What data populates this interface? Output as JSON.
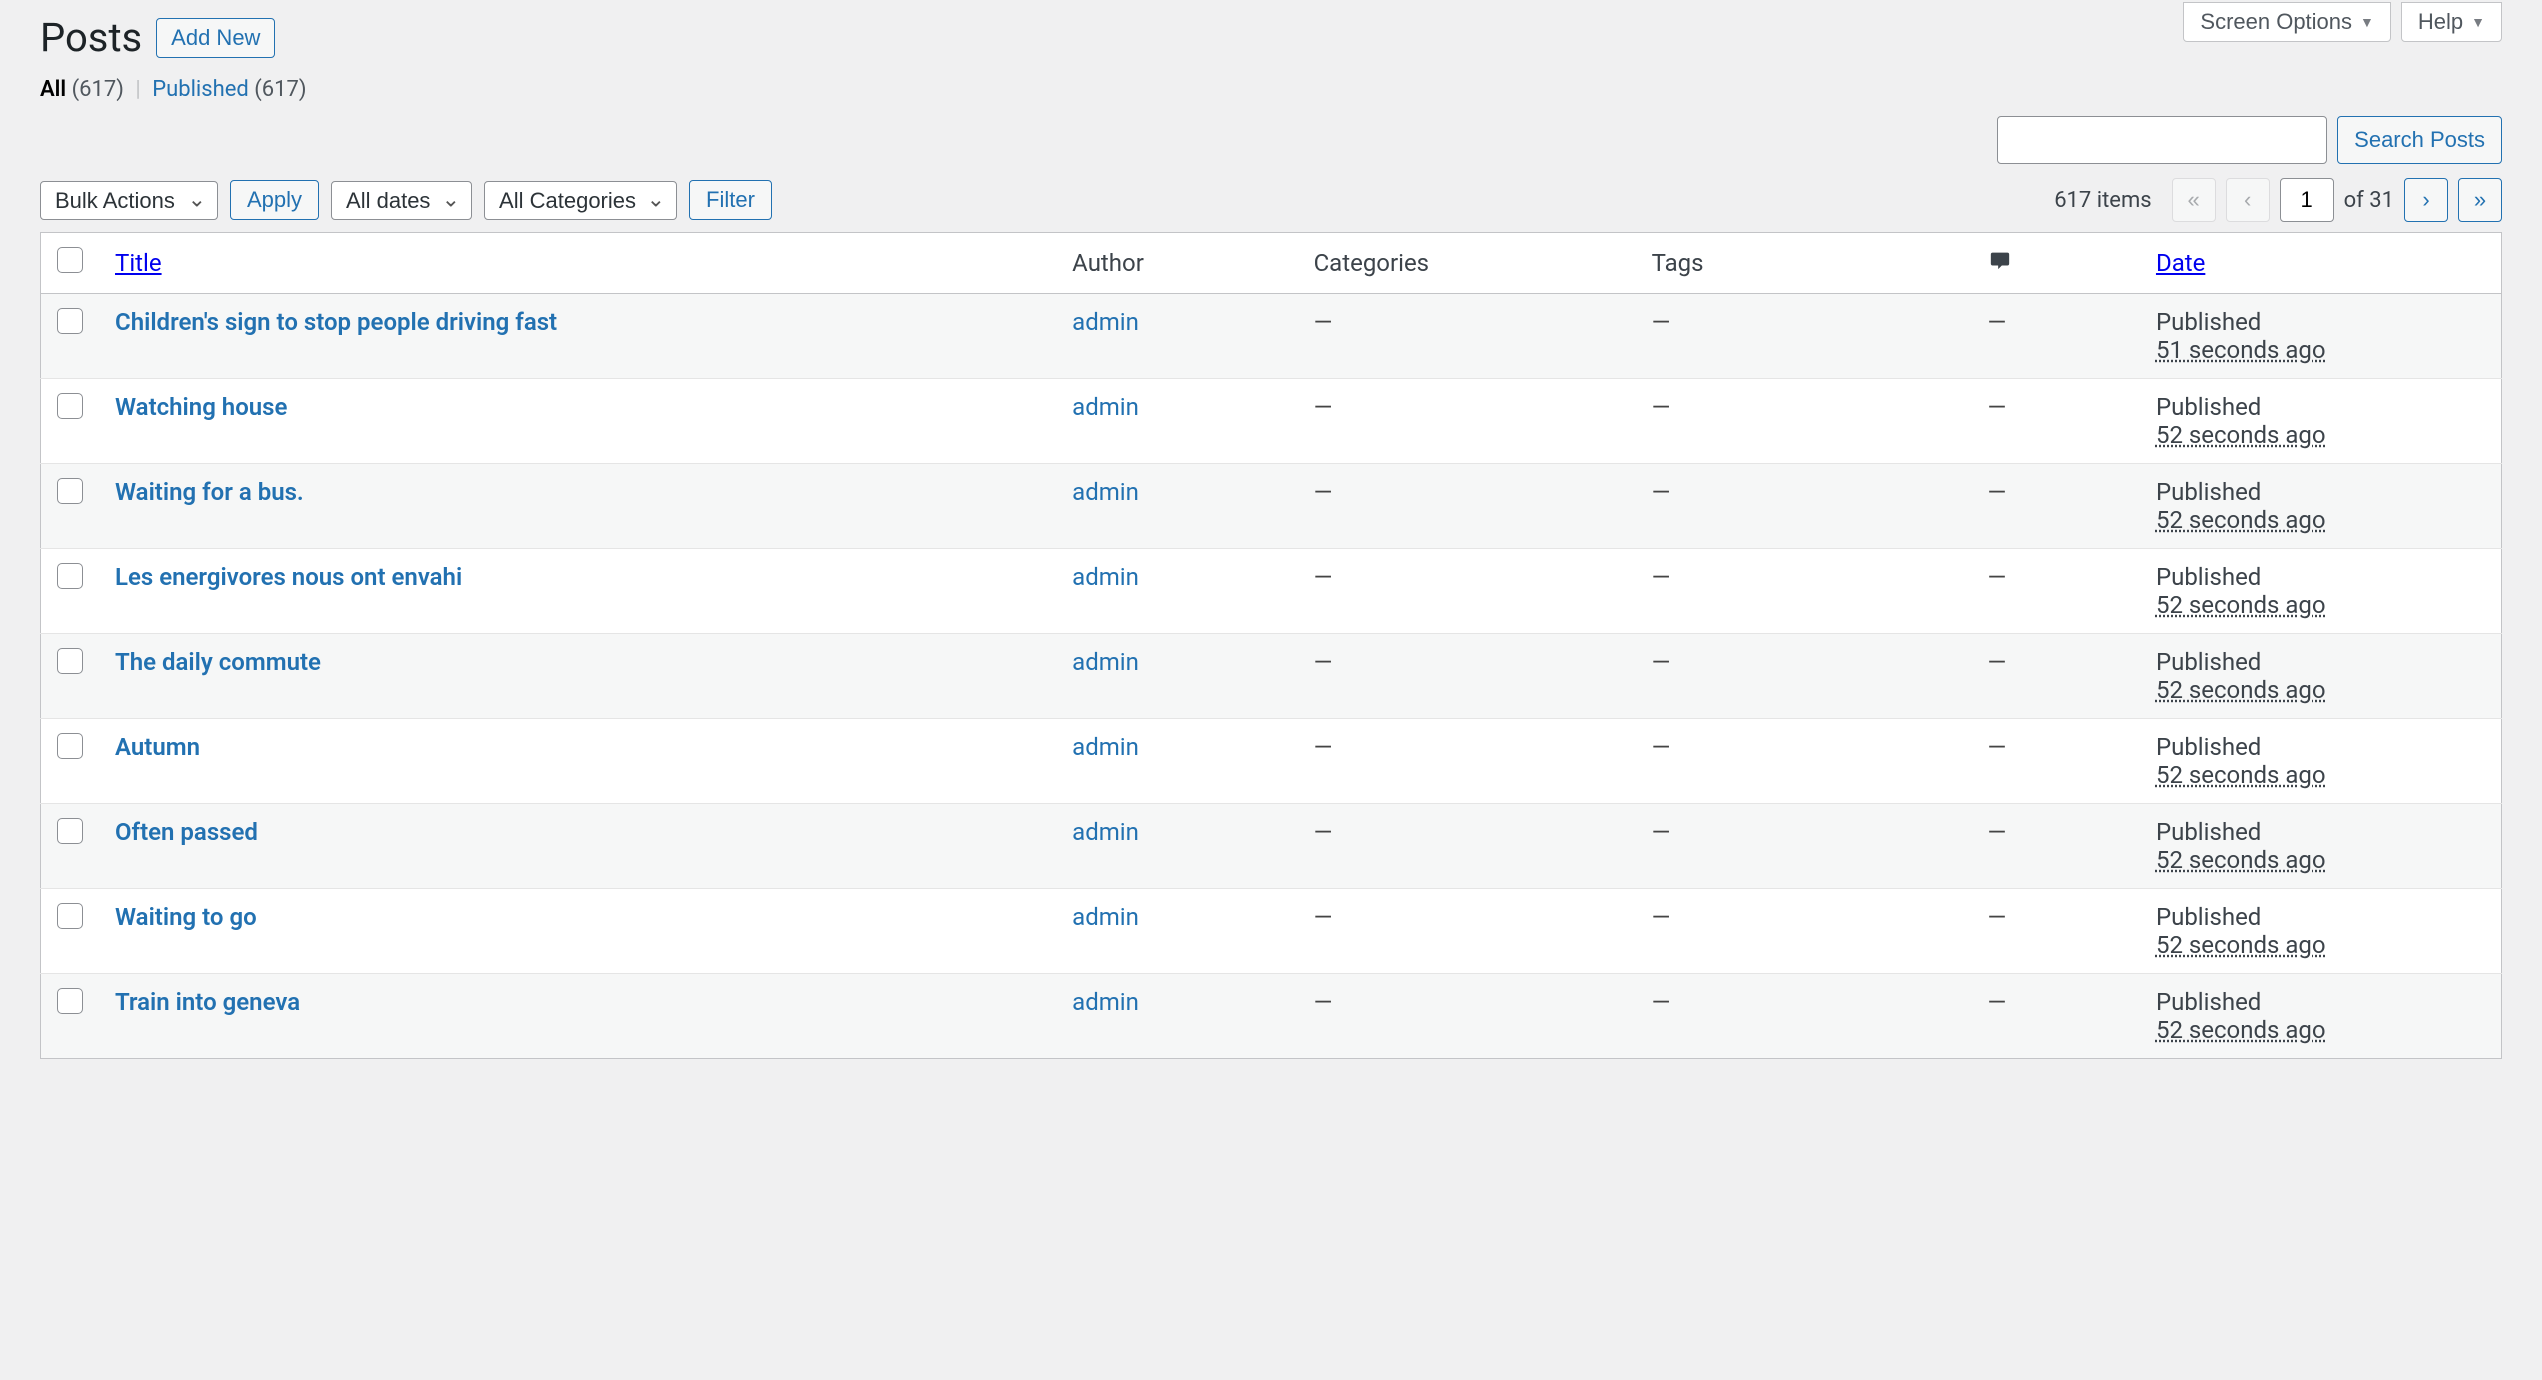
{
  "topRight": {
    "screenOptions": "Screen Options",
    "help": "Help"
  },
  "header": {
    "title": "Posts",
    "addNew": "Add New"
  },
  "subsub": {
    "allLabel": "All",
    "allCount": "(617)",
    "publishedLabel": "Published",
    "publishedCount": "(617)"
  },
  "search": {
    "button": "Search Posts",
    "value": ""
  },
  "filters": {
    "bulk": "Bulk Actions",
    "apply": "Apply",
    "dates": "All dates",
    "cats": "All Categories",
    "filter": "Filter"
  },
  "pagination": {
    "itemsText": "617 items",
    "page": "1",
    "ofText": "of 31"
  },
  "columns": {
    "title": "Title",
    "author": "Author",
    "categories": "Categories",
    "tags": "Tags",
    "date": "Date"
  },
  "dash": "—",
  "rows": [
    {
      "title": "Children's sign to stop people driving fast",
      "author": "admin",
      "categories": "—",
      "tags": "—",
      "comments": "—",
      "status": "Published",
      "rel": "51 seconds ago"
    },
    {
      "title": "Watching house",
      "author": "admin",
      "categories": "—",
      "tags": "—",
      "comments": "—",
      "status": "Published",
      "rel": "52 seconds ago"
    },
    {
      "title": "Waiting for a bus.",
      "author": "admin",
      "categories": "—",
      "tags": "—",
      "comments": "—",
      "status": "Published",
      "rel": "52 seconds ago"
    },
    {
      "title": "Les energivores nous ont envahi",
      "author": "admin",
      "categories": "—",
      "tags": "—",
      "comments": "—",
      "status": "Published",
      "rel": "52 seconds ago"
    },
    {
      "title": "The daily commute",
      "author": "admin",
      "categories": "—",
      "tags": "—",
      "comments": "—",
      "status": "Published",
      "rel": "52 seconds ago"
    },
    {
      "title": "Autumn",
      "author": "admin",
      "categories": "—",
      "tags": "—",
      "comments": "—",
      "status": "Published",
      "rel": "52 seconds ago"
    },
    {
      "title": "Often passed",
      "author": "admin",
      "categories": "—",
      "tags": "—",
      "comments": "—",
      "status": "Published",
      "rel": "52 seconds ago"
    },
    {
      "title": "Waiting to go",
      "author": "admin",
      "categories": "—",
      "tags": "—",
      "comments": "—",
      "status": "Published",
      "rel": "52 seconds ago"
    },
    {
      "title": "Train into geneva",
      "author": "admin",
      "categories": "—",
      "tags": "—",
      "comments": "—",
      "status": "Published",
      "rel": "52 seconds ago"
    }
  ]
}
